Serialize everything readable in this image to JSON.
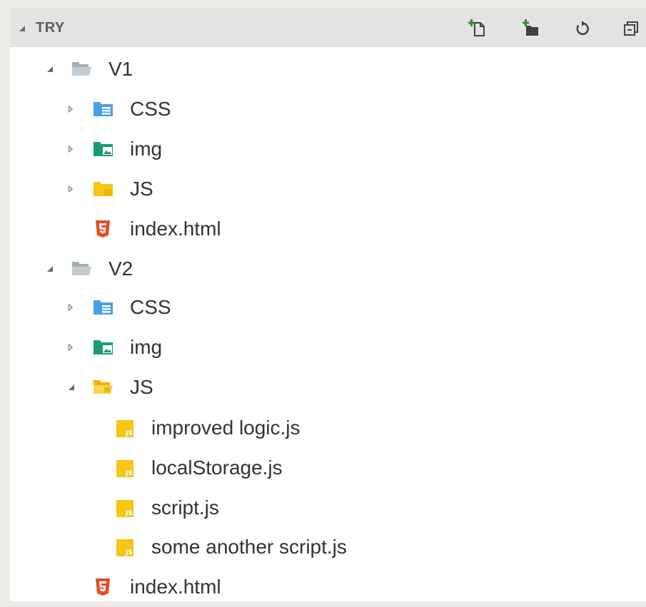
{
  "explorer": {
    "section_title": "TRY",
    "toolbar": [
      {
        "name": "new-file-icon"
      },
      {
        "name": "new-folder-icon"
      },
      {
        "name": "refresh-icon"
      },
      {
        "name": "collapse-all-icon"
      }
    ],
    "tree": [
      {
        "label": "V1",
        "type": "folder",
        "expanded": true
      },
      {
        "label": "CSS",
        "type": "folder-css",
        "expanded": false
      },
      {
        "label": "img",
        "type": "folder-img",
        "expanded": false
      },
      {
        "label": "JS",
        "type": "folder-js",
        "expanded": false
      },
      {
        "label": "index.html",
        "type": "file-html"
      },
      {
        "label": "V2",
        "type": "folder",
        "expanded": true
      },
      {
        "label": "CSS",
        "type": "folder-css",
        "expanded": false
      },
      {
        "label": "img",
        "type": "folder-img",
        "expanded": false
      },
      {
        "label": "JS",
        "type": "folder-js",
        "expanded": true
      },
      {
        "label": "improved logic.js",
        "type": "file-js"
      },
      {
        "label": "localStorage.js",
        "type": "file-js"
      },
      {
        "label": "script.js",
        "type": "file-js"
      },
      {
        "label": "some another script.js",
        "type": "file-js"
      },
      {
        "label": "index.html",
        "type": "file-html"
      }
    ],
    "colors": {
      "css_folder": "#4a9fe8",
      "img_folder": "#1a9a7a",
      "js_folder": "#f5c518",
      "js_file": "#f5c518",
      "html_file": "#e44d26",
      "plain_folder": "#a0a8b0"
    }
  }
}
